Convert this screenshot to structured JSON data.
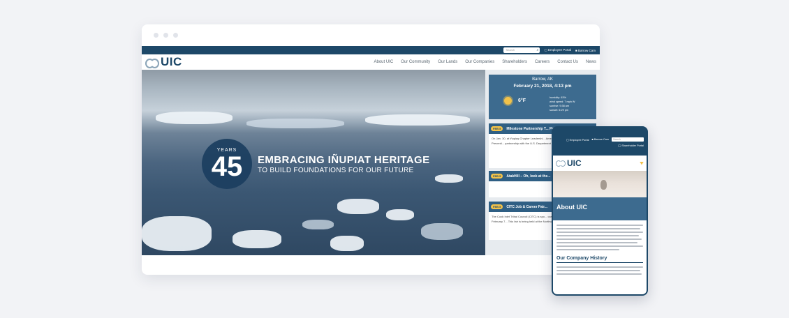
{
  "desktop": {
    "topbar": {
      "search_placeholder": "Search",
      "employee_portal": "Employee Portal",
      "barrow_cam": "Barrow Cam"
    },
    "logo": "UIC",
    "nav": [
      "About UIC",
      "Our Community",
      "Our Lands",
      "Our Companies",
      "Shareholders",
      "Careers",
      "Contact Us",
      "News"
    ],
    "hero": {
      "years_label": "YEARS",
      "years_number": "45",
      "headline": "EMBRACING IÑUPIAT HERITAGE",
      "subheadline": "TO BUILD FOUNDATIONS FOR OUR FUTURE"
    },
    "weather": {
      "location": "Barrow, AK",
      "datetime": "February 21, 2018, 4:13 pm",
      "temperature": "6°F",
      "humidity": "humidity: 63%",
      "wind": "wind speed: 7 mph W",
      "sunrise": "sunrise: 9:38 am",
      "sunset": "sunset: 6:29 pm",
      "icon": "sun-icon"
    },
    "news": [
      {
        "date": "FEB 5",
        "title": "Milestone Partnership T... Prevention",
        "body": "On Jan. 30, at Iñupiaq Chapter Leadershi... American Foundation for Suicide Preventi... partnership with the U.S. Department of... Department of Read More »"
      },
      {
        "date": "FEB 5",
        "title": "AtakHill – Oh, look at the...",
        "body": ""
      },
      {
        "date": "FEB 5",
        "title": "CITC Job & Career Fair...",
        "body": "The Cook Inlet Tribal Council (CITC) is spo... career fair, which is happening February 7... This fair is being held at the Northway Ma..."
      }
    ]
  },
  "mobile": {
    "employee_portal": "Employee Portal",
    "barrow_cam": "Barrow Cam",
    "search_placeholder": "Search",
    "shareholder_portal": "Shareholder Portal",
    "logo": "UIC",
    "page_title": "About UIC",
    "section_heading": "Our Company History"
  }
}
